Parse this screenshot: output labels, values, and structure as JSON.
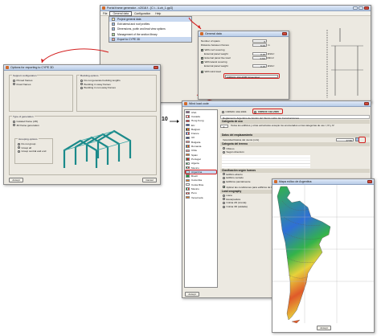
{
  "main_window": {
    "title": "Portal frame generator - v2018.f - [C:\\...\\Luh_1.gp3]",
    "menu": [
      "File",
      "General data",
      "Configuration",
      "Help"
    ],
    "menu_items": [
      "Project general data",
      "Edit lateral and roof profiles",
      "Dimensions, purlin and lead view options",
      "Management of the section library",
      "Export to CYPE 3D"
    ]
  },
  "general_data": {
    "title": "General data",
    "rows": [
      {
        "label": "Number of spans",
        "value": "6"
      },
      {
        "label": "Distance between frames",
        "value": "5.00",
        "unit": "m"
      }
    ],
    "with_roof_covering": "With roof covering",
    "roof_rows": [
      {
        "label": "External panel weight",
        "value": "0.15",
        "unit": "kN/m²"
      },
      {
        "label": "External panel live load",
        "value": "0.60",
        "unit": "kN/m²"
      }
    ],
    "with_lateral_covering": "With lateral covering",
    "lateral_rows": [
      {
        "label": "External panel weight",
        "value": "0.15",
        "unit": "kN/m²"
      }
    ],
    "with_wind_load": "With wind load",
    "wind_value": "CIRSOC 102-2005 (Argentina)"
  },
  "export_window": {
    "title": "Options for exporting to CYPE 3D",
    "support_title": "Support configuration",
    "support_options": [
      "Pinned frames",
      "Fixed frames"
    ],
    "buckling_title": "Buckling options",
    "buckling_options": [
      "Do not generate buckling lengths",
      "Buckling in sway frames",
      "Buckling in non-sway frames"
    ],
    "generation_title": "Type of generation",
    "generation_options": [
      "Isolated frame (2D)",
      "3D frame generation"
    ],
    "grouping_title": "Grouping options",
    "grouping_options": [
      "Do not group",
      "Group all",
      "Group central and end"
    ],
    "accept": "Accept",
    "cancel": "Cancel",
    "badge": "10"
  },
  "wind_window": {
    "title": "Wind load code",
    "countries": [
      "USA",
      "Canada",
      "Hong Kong",
      "EU",
      "Belgium",
      "France",
      "UK",
      "Bulgaria",
      "Romania",
      "Chile",
      "Spain",
      "Portugal",
      "Algeria",
      "Mexico",
      "Argentina",
      "Brazil",
      "Colombia",
      "Costa Rica",
      "Mexico",
      "Peru",
      "Venezuela"
    ],
    "code_options": [
      "CIRSOC 102-1994",
      "CIRSOC 102-2005"
    ],
    "regulation": "Reglamento Argentino de Acción del Viento sobre las Construcciones",
    "category_title": "Categoría de uso",
    "category_value": "II",
    "category_text": "Todos los edificios y otras estructuras excepto los enumerados en las categorías de uso I, III y IV",
    "site_title": "Datos del emplazamiento",
    "wind_speed_label": "Velocidad básica del viento (m/s)",
    "wind_speed_value": "47.50",
    "terrain_title": "Categoría del terreno",
    "terrain_options": [
      "Obtuso",
      "Según dirección"
    ],
    "exposure_title": "Clasificación según huecos",
    "exposure_options": [
      "Edificio abierto",
      "Edificio cerrado",
      "Edificios parcialmente"
    ],
    "apply_label": "Aplicar las condiciones para edificios de baja altura",
    "land_title": "Land orography",
    "land_options": [
      "Llano",
      "Escarpadura",
      "Colina 2D (cresta)",
      "Colina 3D (aislada)"
    ],
    "accept": "Accept",
    "cancel": "Cancel"
  },
  "map_window": {
    "title": "Mapa eólico de Argentina",
    "accept": "Accept"
  },
  "colors": {
    "callout": "#d42020",
    "map_sea": "#9fc3e8",
    "map_high": "#2f6fd6",
    "map_mid": "#33b34a",
    "map_low": "#e8d23a",
    "map_hot": "#e05a2a"
  }
}
